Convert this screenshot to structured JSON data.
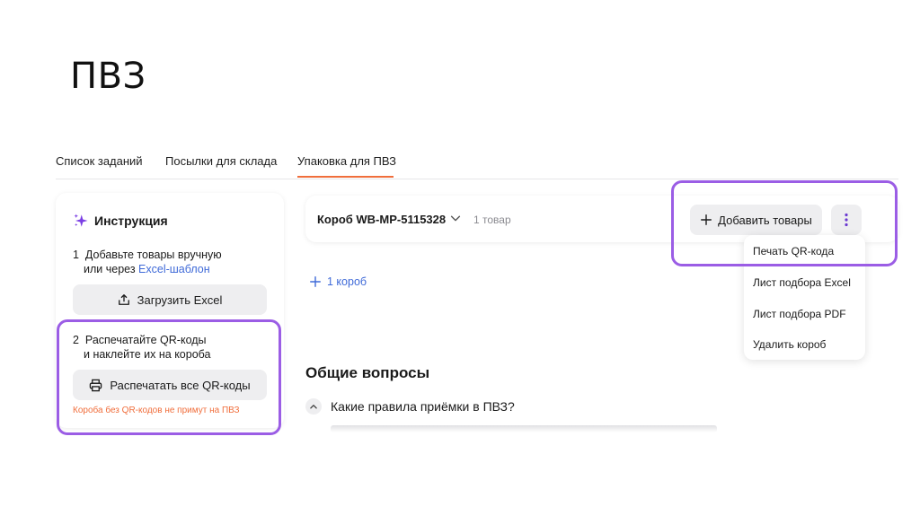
{
  "slide": {
    "title": "ПВЗ"
  },
  "tabs": [
    {
      "label": "Список заданий"
    },
    {
      "label": "Посылки для склада"
    },
    {
      "label": "Упаковка для ПВЗ",
      "active": true
    }
  ],
  "instruction": {
    "title": "Инструкция",
    "step1": {
      "number": "1",
      "line1": "Добавьте товары вручную",
      "line2_prefix": "или через",
      "link": "Excel-шаблон"
    },
    "upload_button": "Загрузить Excel",
    "step2": {
      "number": "2",
      "line1": "Распечатайте QR-коды",
      "line2": "и наклейте их на короба"
    },
    "print_all_button": "Распечатать все QR-коды",
    "warning": "Короба без QR-кодов не примут на ПВЗ"
  },
  "box": {
    "name": "Короб WB-MP-5115328",
    "count": "1 товар",
    "add_button": "Добавить товары",
    "menu": [
      "Печать QR-кода",
      "Лист подбора Excel",
      "Лист подбора PDF",
      "Удалить короб"
    ]
  },
  "add_box": "1 короб",
  "faq": {
    "title": "Общие вопросы",
    "question": "Какие правила приёмки в ПВЗ?"
  },
  "colors": {
    "accent_orange": "#f06e3c",
    "highlight_purple": "#9b5de5",
    "link_blue": "#3f6ad8",
    "sparkle_purple": "#7b3fe4"
  }
}
